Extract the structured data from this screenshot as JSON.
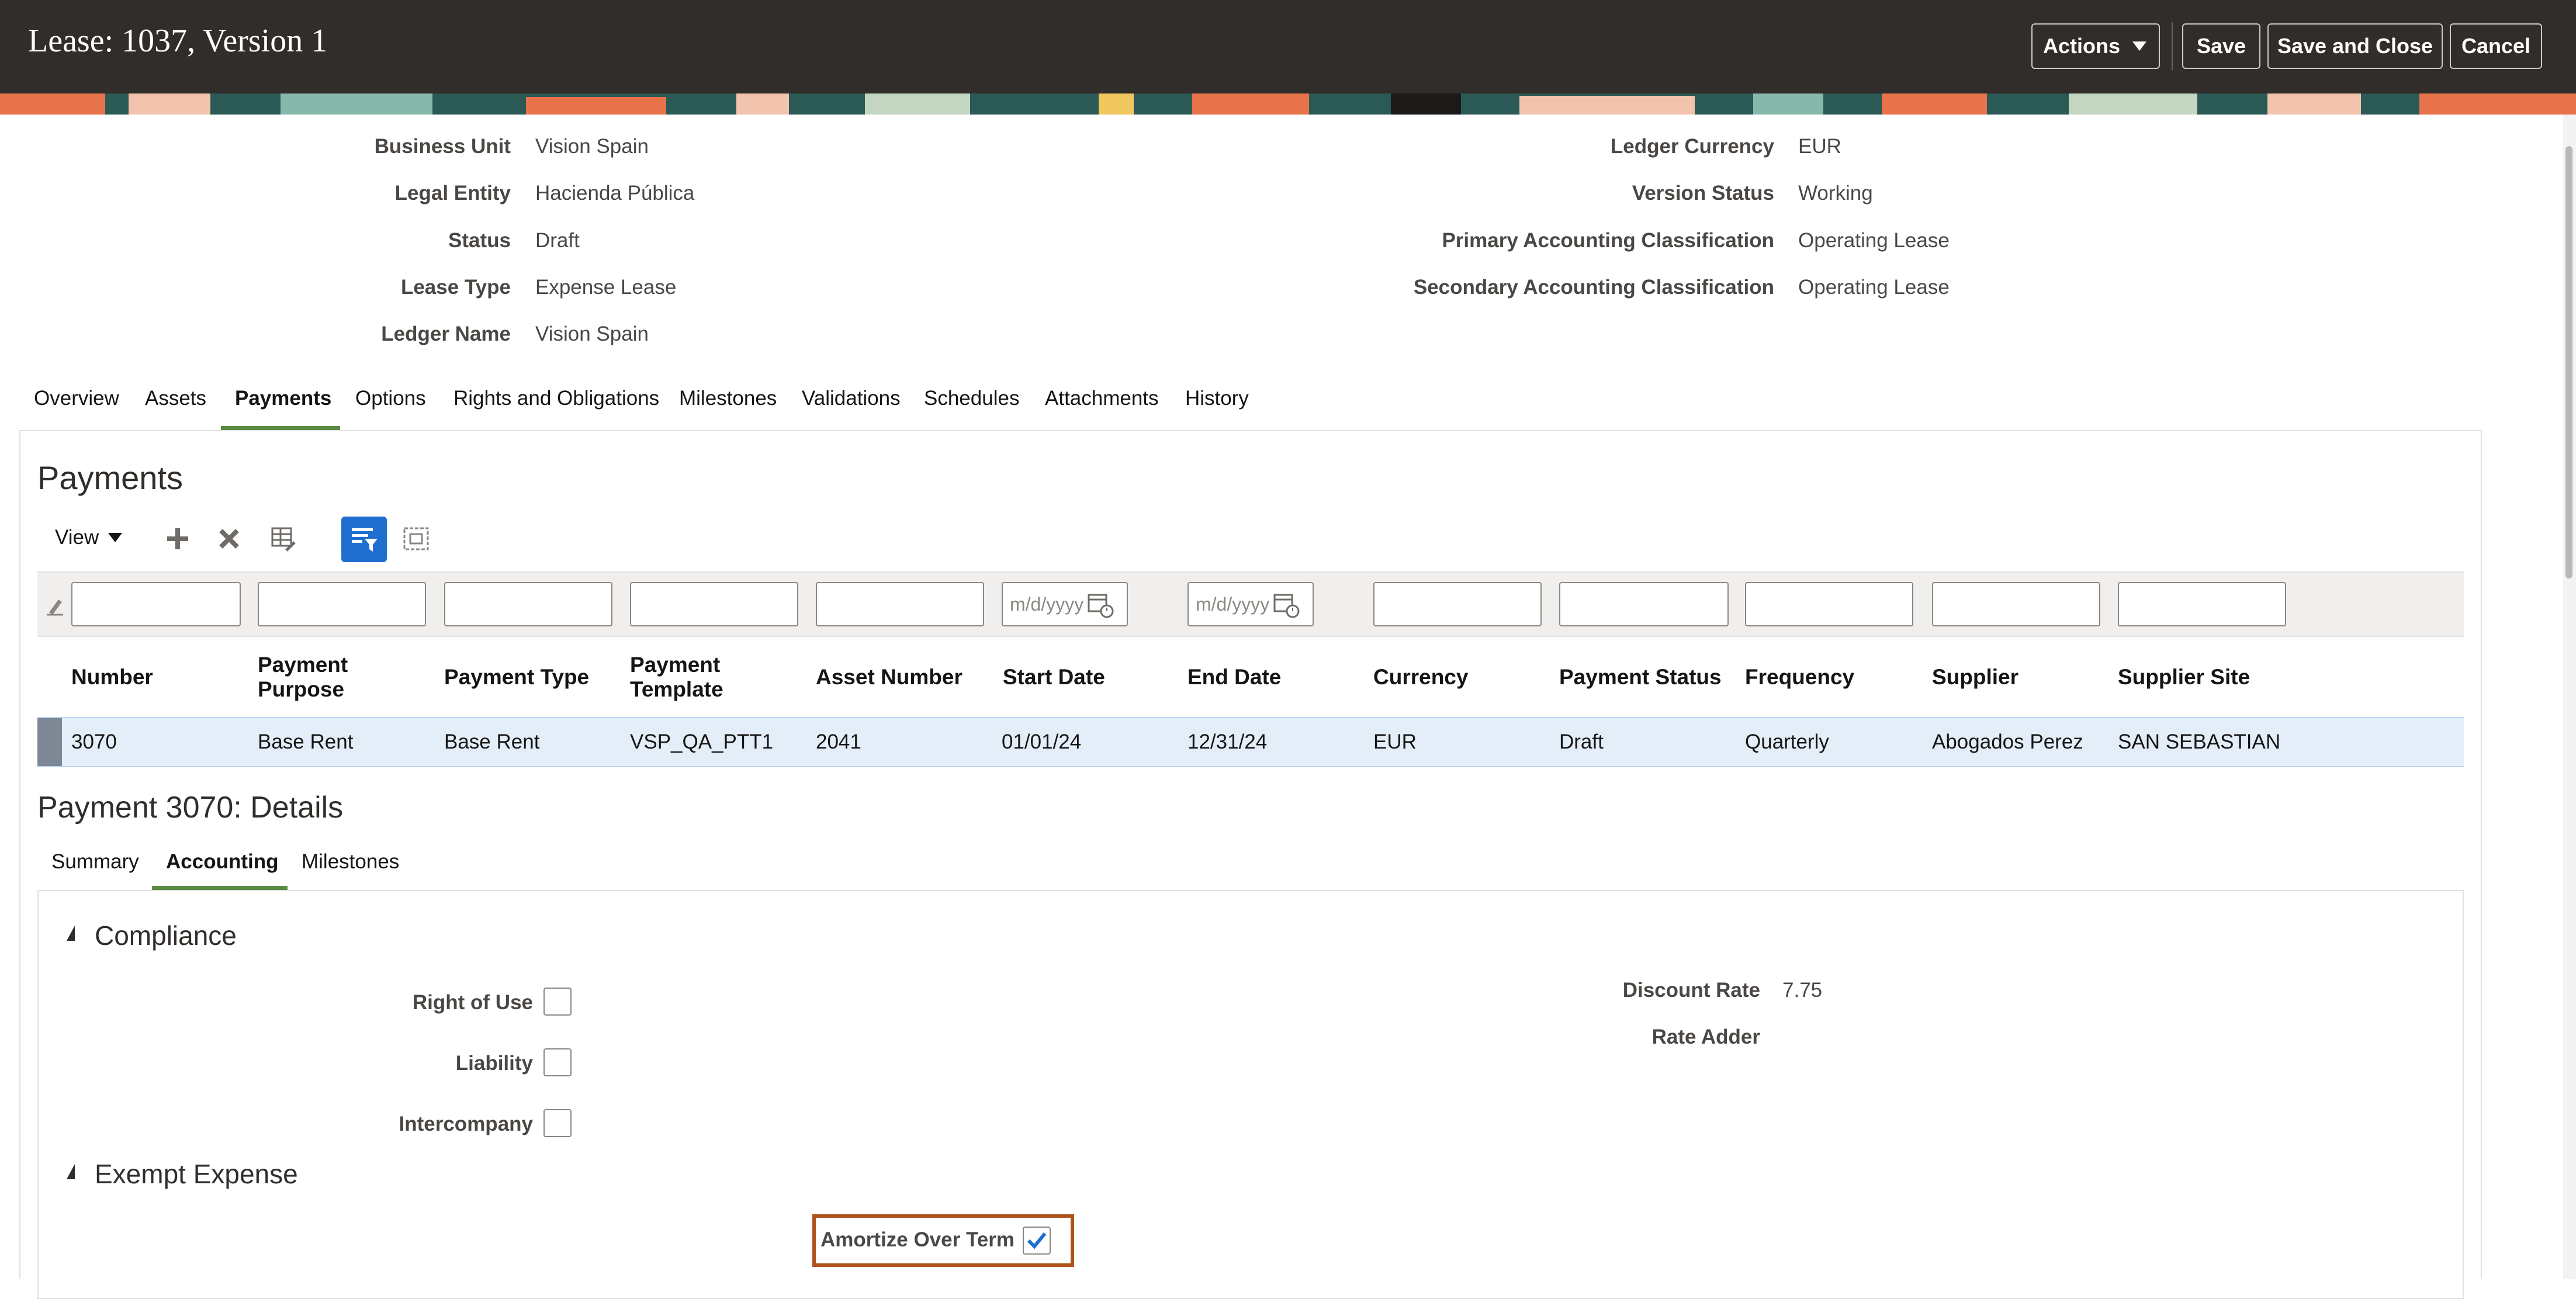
{
  "header": {
    "title": "Lease: 1037, Version 1",
    "actions_label": "Actions",
    "save_label": "Save",
    "save_close_label": "Save and Close",
    "cancel_label": "Cancel"
  },
  "info_left": [
    {
      "label": "Business Unit",
      "value": "Vision Spain"
    },
    {
      "label": "Legal Entity",
      "value": "Hacienda Pública"
    },
    {
      "label": "Status",
      "value": "Draft"
    },
    {
      "label": "Lease Type",
      "value": "Expense Lease"
    },
    {
      "label": "Ledger Name",
      "value": "Vision Spain"
    }
  ],
  "info_right": [
    {
      "label": "Ledger Currency",
      "value": "EUR"
    },
    {
      "label": "Version Status",
      "value": "Working"
    },
    {
      "label": "Primary Accounting Classification",
      "value": "Operating Lease"
    },
    {
      "label": "Secondary Accounting Classification",
      "value": "Operating Lease"
    }
  ],
  "tabs": [
    {
      "label": "Overview"
    },
    {
      "label": "Assets"
    },
    {
      "label": "Payments",
      "active": true
    },
    {
      "label": "Options"
    },
    {
      "label": "Rights and Obligations"
    },
    {
      "label": "Milestones"
    },
    {
      "label": "Validations"
    },
    {
      "label": "Schedules"
    },
    {
      "label": "Attachments"
    },
    {
      "label": "History"
    }
  ],
  "payments": {
    "heading": "Payments",
    "view_label": "View",
    "date_placeholder": "m/d/yyyy",
    "columns": [
      {
        "line1": "Number",
        "line2": ""
      },
      {
        "line1": "Payment",
        "line2": "Purpose"
      },
      {
        "line1": "Payment Type",
        "line2": ""
      },
      {
        "line1": "Payment",
        "line2": "Template"
      },
      {
        "line1": "Asset Number",
        "line2": ""
      },
      {
        "line1": "Start Date",
        "line2": ""
      },
      {
        "line1": "End Date",
        "line2": ""
      },
      {
        "line1": "Currency",
        "line2": ""
      },
      {
        "line1": "Payment Status",
        "line2": ""
      },
      {
        "line1": "Frequency",
        "line2": ""
      },
      {
        "line1": "Supplier",
        "line2": ""
      },
      {
        "line1": "Supplier Site",
        "line2": ""
      }
    ],
    "rows": [
      [
        "3070",
        "Base Rent",
        "Base Rent",
        "VSP_QA_PTT1",
        "2041",
        "01/01/24",
        "12/31/24",
        "EUR",
        "Draft",
        "Quarterly",
        "Abogados Perez",
        "SAN SEBASTIAN"
      ]
    ]
  },
  "details": {
    "title": "Payment 3070: Details",
    "subtabs": [
      {
        "label": "Summary"
      },
      {
        "label": "Accounting",
        "active": true
      },
      {
        "label": "Milestones"
      }
    ],
    "compliance": {
      "title": "Compliance",
      "right_of_use_label": "Right of Use",
      "right_of_use_checked": false,
      "liability_label": "Liability",
      "liability_checked": false,
      "intercompany_label": "Intercompany",
      "intercompany_checked": false,
      "discount_rate_label": "Discount Rate",
      "discount_rate_value": "7.75",
      "rate_adder_label": "Rate Adder",
      "rate_adder_value": ""
    },
    "exempt_expense": {
      "title": "Exempt Expense",
      "amortize_label": "Amortize Over Term",
      "amortize_checked": true
    }
  },
  "colors": {
    "header_bg": "#312d2a",
    "accent_green": "#5a8c43",
    "selected_row": "#e3eef9",
    "highlight_border": "#b0521c",
    "primary_blue": "#1f6fd0"
  }
}
